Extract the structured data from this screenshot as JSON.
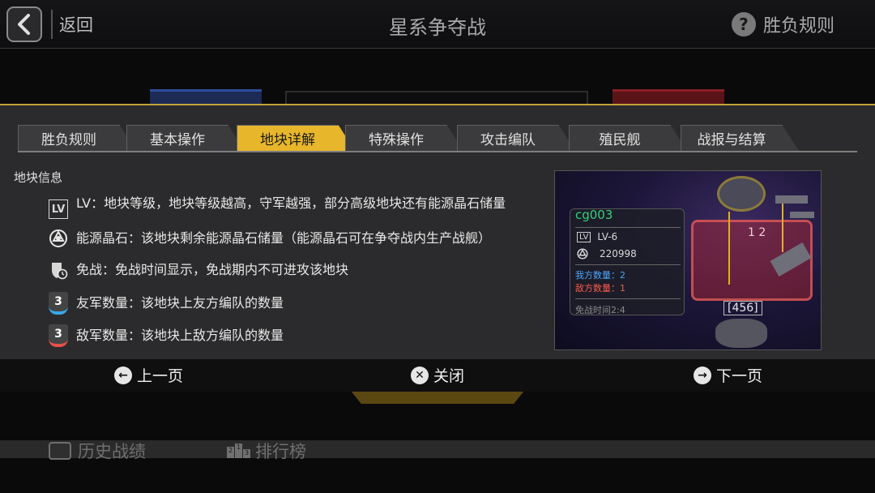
{
  "header": {
    "back_label": "返回",
    "title": "星系争夺战",
    "rules_label": "胜负规则"
  },
  "tabs": [
    {
      "label": "胜负规则",
      "active": false
    },
    {
      "label": "基本操作",
      "active": false
    },
    {
      "label": "地块详解",
      "active": true
    },
    {
      "label": "特殊操作",
      "active": false
    },
    {
      "label": "攻击编队",
      "active": false
    },
    {
      "label": "殖民舰",
      "active": false
    },
    {
      "label": "战报与结算",
      "active": false
    }
  ],
  "content": {
    "section_title": "地块信息",
    "items": [
      {
        "icon": "lv-icon",
        "icon_text": "LV",
        "text": "LV：地块等级，地块等级越高，守军越强，部分高级地块还有能源晶石储量"
      },
      {
        "icon": "energy-crystal-icon",
        "text": "能源晶石：该地块剩余能源晶石储量（能源晶石可在争夺战内生产战舰）"
      },
      {
        "icon": "truce-shield-icon",
        "text": "免战：免战时间显示，免战期内不可进攻该地块"
      },
      {
        "icon": "ally-count-badge-icon",
        "icon_text": "3",
        "text": "友军数量：该地块上友方编队的数量"
      },
      {
        "icon": "enemy-count-badge-icon",
        "icon_text": "3",
        "text": "敌军数量：该地块上敌方编队的数量"
      }
    ]
  },
  "preview": {
    "name": "cg003",
    "lv_box": "LV",
    "level": "LV-6",
    "crystal": "220998",
    "ally_label": "我方数量：2",
    "enemy_label": "敌方数量：1",
    "truce_label": "免战时间2:4",
    "zone_label": "1 2",
    "zone_bottom_label": "[456]"
  },
  "nav": {
    "prev_label": "上一页",
    "close_label": "关闭",
    "next_label": "下一页"
  },
  "background": {
    "history_label": "历史战绩",
    "rank_label": "排行榜",
    "rank_digits": [
      "2",
      "1",
      "3"
    ]
  },
  "colors": {
    "accent_gold": "#e8b62a",
    "ally_blue": "#37a8e8",
    "enemy_red": "#e8504a",
    "tile_name_green": "#32d27a"
  }
}
